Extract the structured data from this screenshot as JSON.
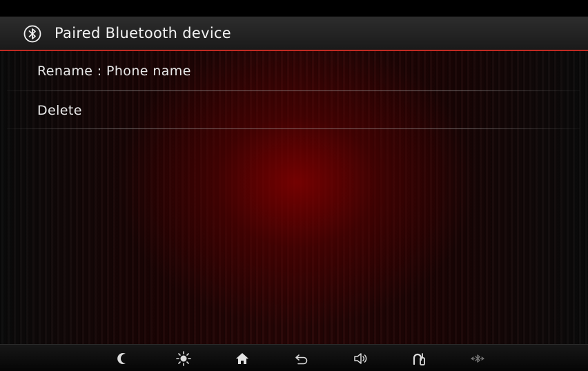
{
  "header": {
    "title": "Paired Bluetooth device",
    "icon": "bluetooth-icon"
  },
  "menu": {
    "items": [
      {
        "label": "Rename : Phone name"
      },
      {
        "label": "Delete"
      }
    ]
  },
  "bottom_bar": {
    "icons": [
      "moon-icon",
      "brightness-icon",
      "home-icon",
      "back-icon",
      "volume-icon",
      "phone-projection-icon",
      "bluetooth-connection-icon"
    ]
  },
  "colors": {
    "accent_line": "#c22a22",
    "background_glow": "#820000",
    "text": "#e8e8e8"
  }
}
